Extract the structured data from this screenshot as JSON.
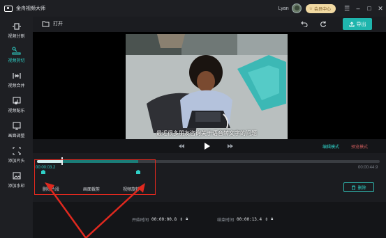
{
  "app": {
    "title": "金舟视频大师"
  },
  "titlebar": {
    "user_name": "Lyan",
    "vip_label": "会员中心"
  },
  "sidebar": {
    "items": [
      {
        "label": "视频分割",
        "icon": "split-icon"
      },
      {
        "label": "视频剪切",
        "icon": "scissors-icon",
        "active": true
      },
      {
        "label": "视频合并",
        "icon": "merge-icon"
      },
      {
        "label": "视频配乐",
        "icon": "music-icon"
      },
      {
        "label": "画面调整",
        "icon": "crop-icon"
      },
      {
        "label": "添加片头",
        "icon": "intro-icon"
      },
      {
        "label": "添加水印",
        "icon": "watermark-icon"
      }
    ]
  },
  "toolbar": {
    "open_label": "打开",
    "export_label": "导出"
  },
  "preview": {
    "subtitle": "最近很多朋友咨询关于语音转文字的问题"
  },
  "playback": {
    "mode_edit": "编辑模式",
    "mode_preview": "预览模式"
  },
  "timeline": {
    "current_time": "00:00:03.2",
    "total_time": "00:00:44.9",
    "progress": 0.07
  },
  "tabs": [
    "删除片段",
    "画面裁剪",
    "视频旋转"
  ],
  "actions": {
    "delete_label": "删除"
  },
  "trim": {
    "start_label": "开始时间",
    "start_value": "00:00:00.8",
    "end_label": "结束时间",
    "end_value": "00:00:13.4"
  },
  "colors": {
    "accent": "#1fb5ad",
    "highlight": "#e0291f",
    "vip": "#f1d9a2"
  }
}
